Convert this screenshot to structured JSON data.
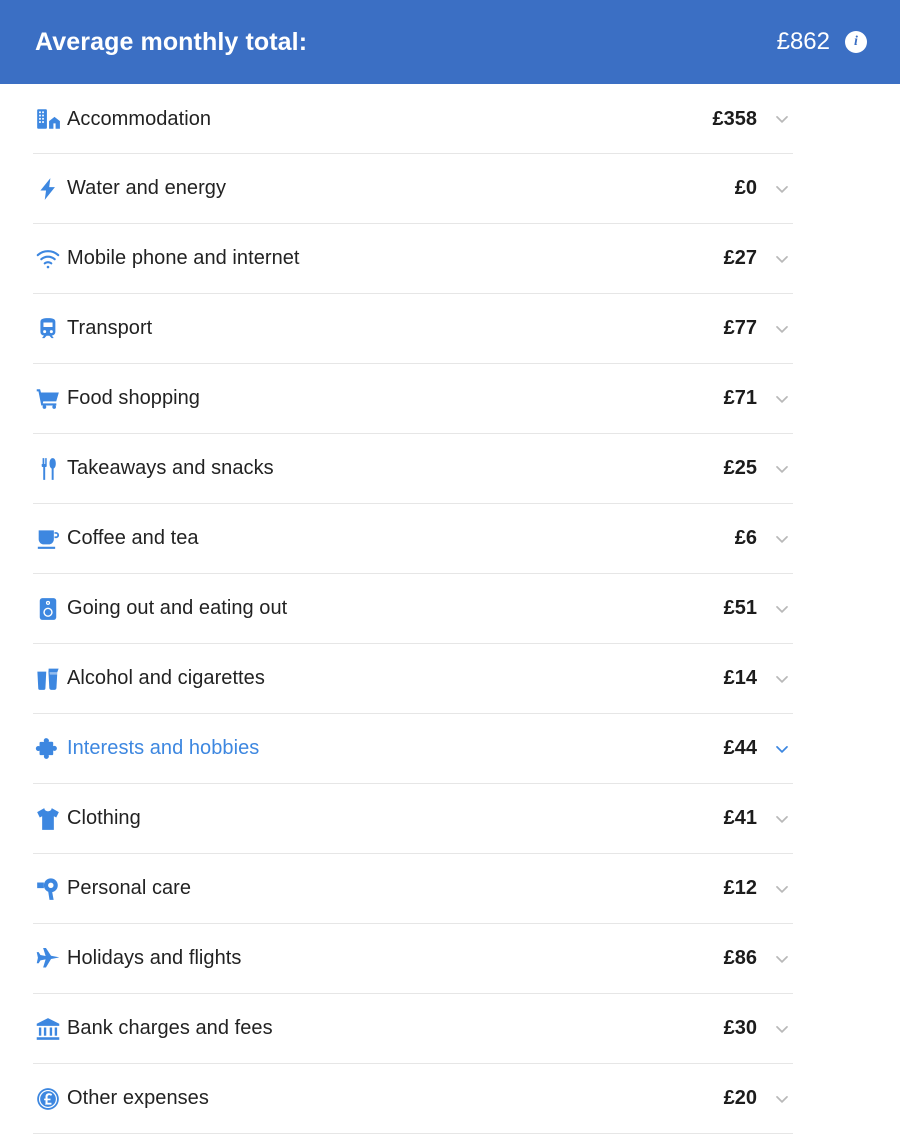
{
  "header": {
    "title": "Average monthly total:",
    "amount": "£862",
    "info_icon": "info-icon",
    "background_color": "#3b6fc4",
    "text_color": "#ffffff"
  },
  "theme": {
    "accent": "#3d87e0",
    "header_blue": "#3b6fc4",
    "divider": "#e6e6e6",
    "label_text": "#222222",
    "chevron": "#b9b9b9"
  },
  "list": {
    "chevron_icon": "chevron-down-icon",
    "rows": [
      {
        "icon": "buildings-icon",
        "label": "Accommodation",
        "amount": "£358",
        "active": false
      },
      {
        "icon": "lightning-icon",
        "label": "Water and energy",
        "amount": "£0",
        "active": false
      },
      {
        "icon": "wifi-icon",
        "label": "Mobile phone and internet",
        "amount": "£27",
        "active": false
      },
      {
        "icon": "train-icon",
        "label": "Transport",
        "amount": "£77",
        "active": false
      },
      {
        "icon": "shopping-cart-icon",
        "label": "Food shopping",
        "amount": "£71",
        "active": false
      },
      {
        "icon": "cutlery-icon",
        "label": "Takeaways and snacks",
        "amount": "£25",
        "active": false
      },
      {
        "icon": "coffee-cup-icon",
        "label": "Coffee and tea",
        "amount": "£6",
        "active": false
      },
      {
        "icon": "speaker-icon",
        "label": "Going out and eating out",
        "amount": "£51",
        "active": false
      },
      {
        "icon": "drinks-icon",
        "label": "Alcohol and cigarettes",
        "amount": "£14",
        "active": false
      },
      {
        "icon": "puzzle-piece-icon",
        "label": "Interests and hobbies",
        "amount": "£44",
        "active": true
      },
      {
        "icon": "tshirt-icon",
        "label": "Clothing",
        "amount": "£41",
        "active": false
      },
      {
        "icon": "hairdryer-icon",
        "label": "Personal care",
        "amount": "£12",
        "active": false
      },
      {
        "icon": "airplane-icon",
        "label": "Holidays and flights",
        "amount": "£86",
        "active": false
      },
      {
        "icon": "bank-icon",
        "label": "Bank charges and fees",
        "amount": "£30",
        "active": false
      },
      {
        "icon": "pound-coin-icon",
        "label": "Other expenses",
        "amount": "£20",
        "active": false
      }
    ]
  }
}
